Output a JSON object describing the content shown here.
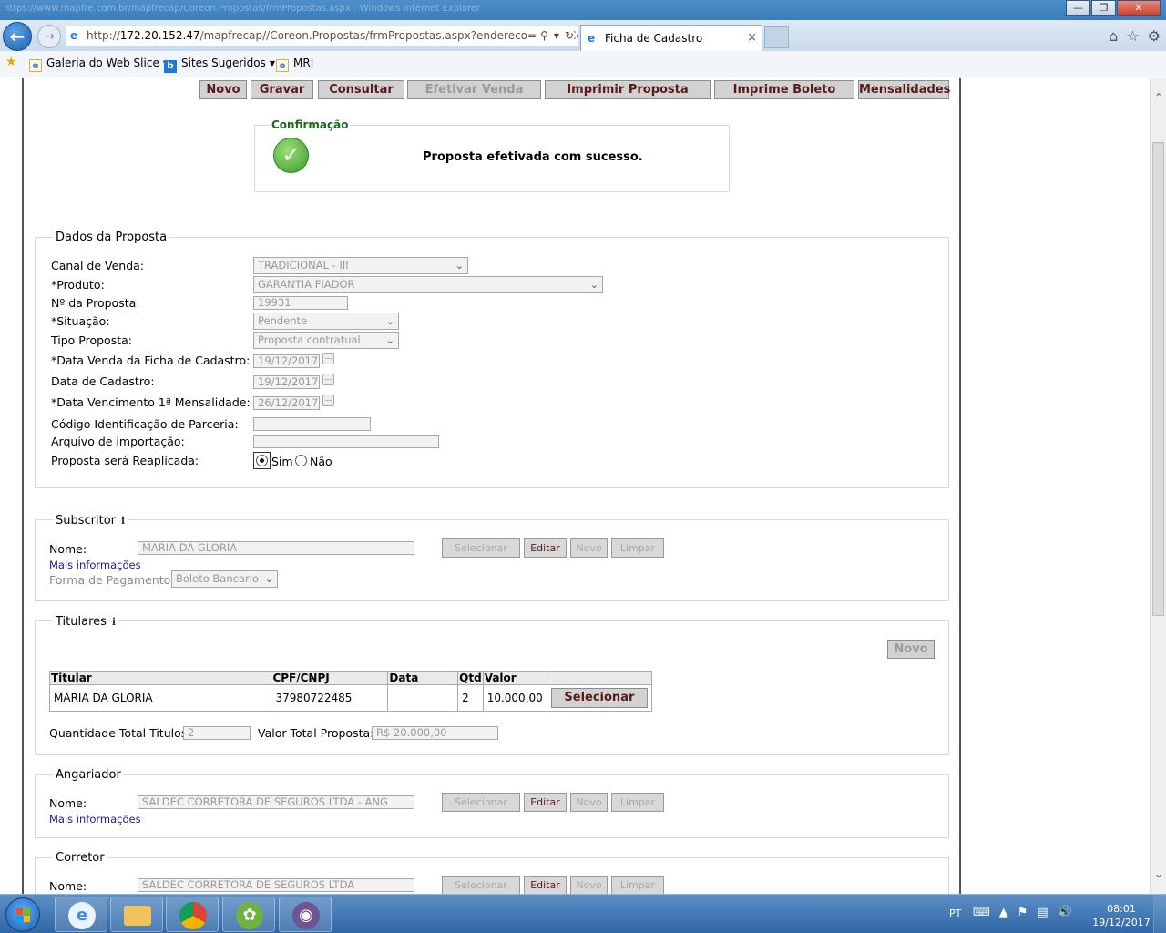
{
  "browser": {
    "ghost_title": "https://www.mapfre.com.br/mapfrecap/Coreon.Propostas/frmPropostas.aspx - Windows Internet Explorer",
    "address_prefix": "http://",
    "address_host": "172.20.152.47",
    "address_rest": "/mapfrecap//Coreon.Propostas/frmPropostas.aspx?endereco=../../../Co",
    "tab_title": "Ficha de Cadastro",
    "favorites": [
      {
        "label": "Galeria do Web Slice"
      },
      {
        "label": "Sites Sugeridos"
      },
      {
        "label": "MRI"
      }
    ]
  },
  "toolbar": {
    "buttons": [
      {
        "label": "Novo",
        "enabled": true
      },
      {
        "label": "Gravar",
        "enabled": true
      },
      {
        "label": "Consultar",
        "enabled": true
      },
      {
        "label": "Efetivar Venda",
        "enabled": false
      },
      {
        "label": "Imprimir Proposta",
        "enabled": true
      },
      {
        "label": "Imprime Boleto",
        "enabled": true
      },
      {
        "label": "Mensalidades",
        "enabled": true
      }
    ]
  },
  "confirmation": {
    "legend": "Confirmação",
    "message": "Proposta efetivada com sucesso."
  },
  "dados": {
    "legend": "Dados da Proposta",
    "canal_label": "Canal de Venda:",
    "canal_value": "TRADICIONAL - III",
    "produto_label": "*Produto:",
    "produto_value": "GARANTIA FIADOR",
    "numero_label": "Nº da Proposta:",
    "numero_value": "19931",
    "situacao_label": "*Situação:",
    "situacao_value": "Pendente",
    "tipo_label": "Tipo Proposta:",
    "tipo_value": "Proposta contratual",
    "data_venda_label": "*Data Venda da Ficha de Cadastro:",
    "data_venda_value": "19/12/2017",
    "data_cadastro_label": "Data de Cadastro:",
    "data_cadastro_value": "19/12/2017",
    "data_venc_label": "*Data Vencimento 1ª Mensalidade:",
    "data_venc_value": "26/12/2017",
    "codigo_label": "Código Identificação de Parceria:",
    "codigo_value": "",
    "arquivo_label": "Arquivo de importação:",
    "arquivo_value": "",
    "reaplicada_label": "Proposta será Reaplicada:",
    "opt_sim": "Sim",
    "opt_nao": "Não",
    "reaplicada_selected": "Sim"
  },
  "subscritor": {
    "legend": "Subscritor",
    "info": "i",
    "nome_label": "Nome:",
    "nome_value": "MARIA DA GLORIA",
    "btn_selecionar": "Selecionar",
    "btn_editar": "Editar",
    "btn_novo": "Novo",
    "btn_limpar": "Limpar",
    "mais_info": "Mais informações",
    "pagamento_label": "Forma de Pagamento:",
    "pagamento_value": "Boleto Bancario"
  },
  "titulares": {
    "legend": "Titulares",
    "info": "i",
    "btn_novo": "Novo",
    "columns": [
      "Titular",
      "CPF/CNPJ",
      "Data",
      "Qtd",
      "Valor",
      ""
    ],
    "rows": [
      {
        "titular": "MARIA DA GLORIA",
        "cpf": "37980722485",
        "data": "",
        "qtd": "2",
        "valor": "10.000,00",
        "action": "Selecionar"
      }
    ],
    "qtd_total_label": "Quantidade Total Titulos:",
    "qtd_total_value": "2",
    "valor_total_label": "Valor Total Proposta:",
    "valor_total_value": "R$ 20.000,00"
  },
  "angariador": {
    "legend": "Angariador",
    "nome_label": "Nome:",
    "nome_value": "SALDEC CORRETORA DE SEGUROS LTDA - ANG",
    "btn_selecionar": "Selecionar",
    "btn_editar": "Editar",
    "btn_novo": "Novo",
    "btn_limpar": "Limpar",
    "mais_info": "Mais informações"
  },
  "corretor": {
    "legend": "Corretor",
    "nome_label": "Nome:",
    "nome_value": "SALDEC CORRETORA DE SEGUROS LTDA",
    "btn_selecionar": "Selecionar",
    "btn_editar": "Editar",
    "btn_novo": "Novo",
    "btn_limpar": "Limpar"
  },
  "taskbar": {
    "lang": "PT",
    "time": "08:01",
    "date": "19/12/2017"
  }
}
